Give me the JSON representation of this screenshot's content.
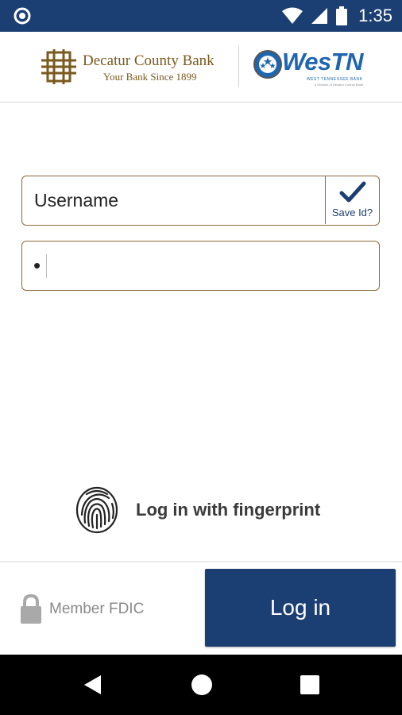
{
  "status_bar": {
    "time": "1:35",
    "icons": [
      "app-circle-icon",
      "wifi-icon",
      "signal-icon",
      "battery-icon"
    ]
  },
  "header": {
    "bank_name": "Decatur County Bank",
    "bank_tagline": "Your Bank Since 1899",
    "partner_name": "WesTN",
    "partner_subtitle": "WEST TENNESSEE BANK",
    "partner_subtitle2": "a Division of Decatur County Bank"
  },
  "login_form": {
    "username_placeholder": "Username",
    "save_id_label": "Save Id?",
    "save_id_checked": true,
    "password_value": "•"
  },
  "fingerprint": {
    "label": "Log in with fingerprint"
  },
  "footer": {
    "member_fdic": "Member FDIC",
    "login_button_label": "Log in"
  },
  "colors": {
    "primary": "#1b3f73",
    "field_border": "#8a6a3a",
    "bank_gold": "#7a5a1e",
    "partner_blue": "#1f66b0"
  }
}
